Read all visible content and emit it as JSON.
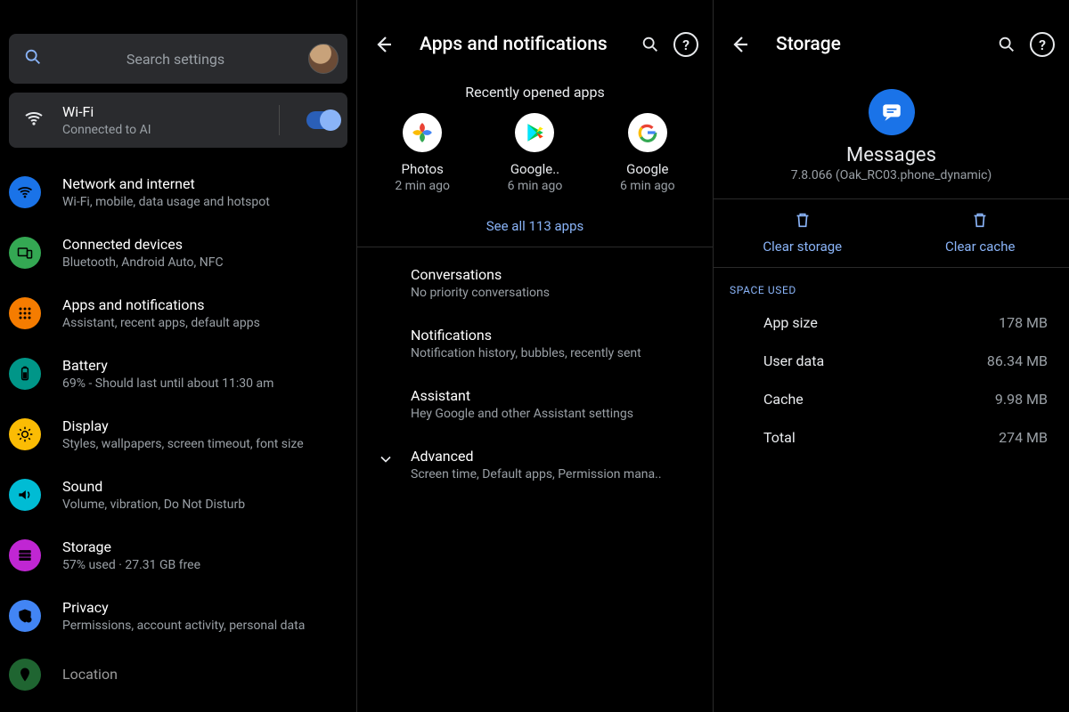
{
  "colors": {
    "link": "#8ab4f8"
  },
  "settings": {
    "search_placeholder": "Search settings",
    "wifi": {
      "title": "Wi-Fi",
      "subtitle": "Connected to AI"
    },
    "items": [
      {
        "title": "Network and internet",
        "subtitle": "Wi-Fi, mobile, data usage and hotspot",
        "color": "#1a73e8",
        "icon": "wifi"
      },
      {
        "title": "Connected devices",
        "subtitle": "Bluetooth, Android Auto, NFC",
        "color": "#34a853",
        "icon": "devices"
      },
      {
        "title": "Apps and notifications",
        "subtitle": "Assistant, recent apps, default apps",
        "color": "#f57c00",
        "icon": "apps"
      },
      {
        "title": "Battery",
        "subtitle": "69% - Should last until about 11:30 am",
        "color": "#009688",
        "icon": "battery"
      },
      {
        "title": "Display",
        "subtitle": "Styles, wallpapers, screen timeout, font size",
        "color": "#fbbc04",
        "icon": "display"
      },
      {
        "title": "Sound",
        "subtitle": "Volume, vibration, Do Not Disturb",
        "color": "#00bcd4",
        "icon": "sound"
      },
      {
        "title": "Storage",
        "subtitle": "57% used · 27.31 GB free",
        "color": "#c026d3",
        "icon": "storage"
      },
      {
        "title": "Privacy",
        "subtitle": "Permissions, account activity, personal data",
        "color": "#4285f4",
        "icon": "privacy"
      },
      {
        "title": "Location",
        "subtitle": "",
        "color": "#34a853",
        "icon": "location"
      }
    ]
  },
  "apps_screen": {
    "title": "Apps and notifications",
    "recent_heading": "Recently opened apps",
    "recent": [
      {
        "name": "Photos",
        "time": "2 min ago",
        "icon": "photos"
      },
      {
        "name": "Google..",
        "time": "6 min ago",
        "icon": "play"
      },
      {
        "name": "Google",
        "time": "6 min ago",
        "icon": "google"
      }
    ],
    "see_all": "See all 113 apps",
    "list": [
      {
        "title": "Conversations",
        "subtitle": "No priority conversations"
      },
      {
        "title": "Notifications",
        "subtitle": "Notification history, bubbles, recently sent"
      },
      {
        "title": "Assistant",
        "subtitle": "Hey Google and other Assistant settings"
      },
      {
        "title": "Advanced",
        "subtitle": "Screen time, Default apps, Permission mana..",
        "expand": true
      }
    ]
  },
  "storage_screen": {
    "title": "Storage",
    "app": {
      "name": "Messages",
      "version": "7.8.066 (Oak_RC03.phone_dynamic)"
    },
    "clear_storage": "Clear storage",
    "clear_cache": "Clear cache",
    "space_used_heading": "SPACE USED",
    "rows": [
      {
        "label": "App size",
        "value": "178 MB"
      },
      {
        "label": "User data",
        "value": "86.34 MB"
      },
      {
        "label": "Cache",
        "value": "9.98 MB"
      },
      {
        "label": "Total",
        "value": "274 MB"
      }
    ]
  }
}
